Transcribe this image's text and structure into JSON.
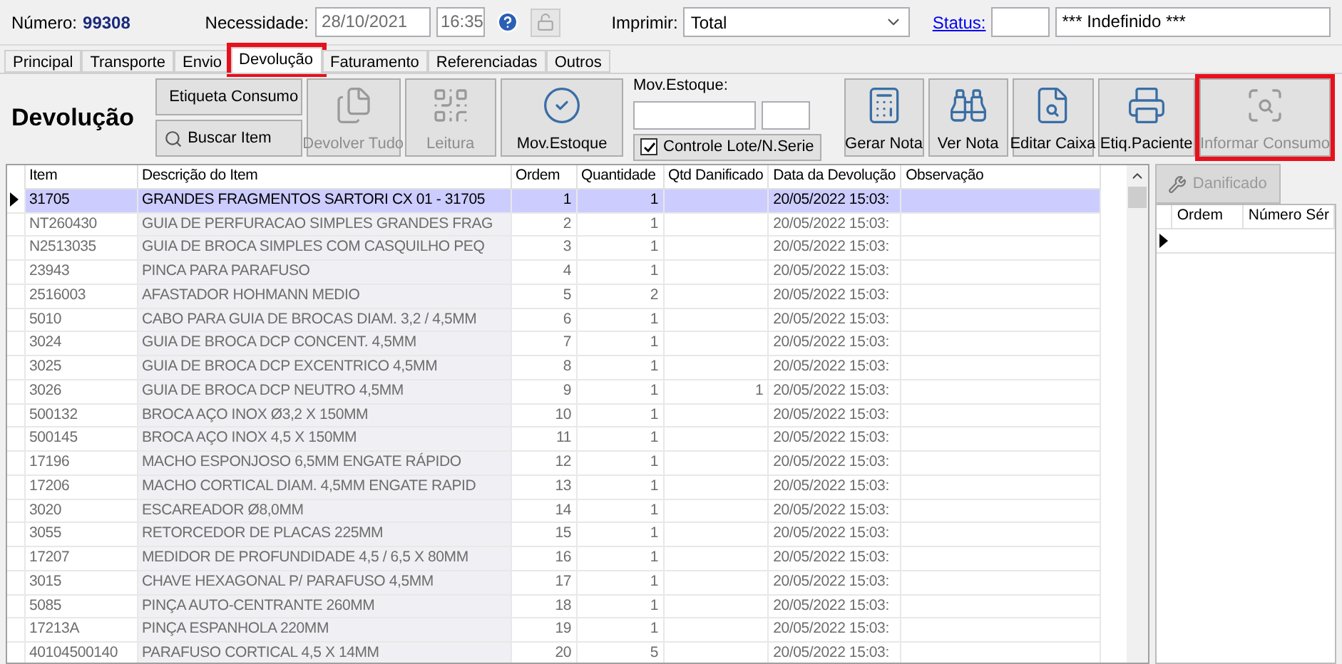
{
  "header": {
    "number_label": "Número:",
    "number": "99308",
    "need_label": "Necessidade:",
    "need_date": "28/10/2021",
    "need_time": "16:35",
    "print_label": "Imprimir:",
    "print_value": "Total",
    "status_label": "Status:",
    "status_text": "*** Indefinido ***"
  },
  "tabs": [
    {
      "label": "Principal",
      "selected": false,
      "highlighted": false
    },
    {
      "label": "Transporte",
      "selected": false,
      "highlighted": false
    },
    {
      "label": "Envio",
      "selected": false,
      "highlighted": false
    },
    {
      "label": "Devolução",
      "selected": true,
      "highlighted": true
    },
    {
      "label": "Faturamento",
      "selected": false,
      "highlighted": false
    },
    {
      "label": "Referenciadas",
      "selected": false,
      "highlighted": false
    },
    {
      "label": "Outros",
      "selected": false,
      "highlighted": false
    }
  ],
  "toolbar": {
    "title": "Devolução",
    "small_buttons": [
      {
        "label": "Etiqueta Consumo"
      },
      {
        "label": "Buscar Item"
      }
    ],
    "buttons_left": [
      {
        "label": "Devolver Tudo",
        "disabled": true,
        "highlighted": false
      },
      {
        "label": "Leitura",
        "disabled": true,
        "highlighted": false
      },
      {
        "label": "Mov.Estoque",
        "disabled": false,
        "highlighted": false
      }
    ],
    "stock": {
      "label": "Mov.Estoque:",
      "check_label": "Controle Lote/N.Serie",
      "checked": true
    },
    "buttons_right": [
      {
        "label": "Gerar Nota",
        "disabled": false,
        "highlighted": false
      },
      {
        "label": "Ver Nota",
        "disabled": false,
        "highlighted": false
      },
      {
        "label": "Editar Caixa",
        "disabled": false,
        "highlighted": false
      },
      {
        "label": "Etiq.Paciente",
        "disabled": false,
        "highlighted": false
      },
      {
        "label": "Informar Consumo",
        "disabled": true,
        "highlighted": true
      }
    ]
  },
  "table": {
    "columns": [
      "Item",
      "Descrição do Item",
      "Ordem",
      "Quantidade",
      "Qtd Danificado",
      "Data da Devolução",
      "Observação"
    ],
    "rows": [
      {
        "selected": true,
        "cells": [
          "31705",
          "GRANDES FRAGMENTOS SARTORI CX 01 - 31705",
          "1",
          "1",
          "",
          "20/05/2022 15:03:",
          ""
        ]
      },
      {
        "selected": false,
        "cells": [
          "NT260430",
          "GUIA DE PERFURACAO SIMPLES GRANDES FRAG",
          "2",
          "1",
          "",
          "20/05/2022 15:03:",
          ""
        ]
      },
      {
        "selected": false,
        "cells": [
          "N2513035",
          "GUIA DE BROCA SIMPLES COM CASQUILHO PEQ",
          "3",
          "1",
          "",
          "20/05/2022 15:03:",
          ""
        ]
      },
      {
        "selected": false,
        "cells": [
          "23943",
          "PINCA PARA PARAFUSO",
          "4",
          "1",
          "",
          "20/05/2022 15:03:",
          ""
        ]
      },
      {
        "selected": false,
        "cells": [
          "2516003",
          "AFASTADOR HOHMANN MEDIO",
          "5",
          "2",
          "",
          "20/05/2022 15:03:",
          ""
        ]
      },
      {
        "selected": false,
        "cells": [
          "5010",
          "CABO PARA GUIA DE BROCAS DIAM. 3,2 / 4,5MM",
          "6",
          "1",
          "",
          "20/05/2022 15:03:",
          ""
        ]
      },
      {
        "selected": false,
        "cells": [
          "3024",
          "GUIA DE BROCA DCP CONCENT. 4,5MM",
          "7",
          "1",
          "",
          "20/05/2022 15:03:",
          ""
        ]
      },
      {
        "selected": false,
        "cells": [
          "3025",
          "GUIA DE BROCA DCP EXCENTRICO 4,5MM",
          "8",
          "1",
          "",
          "20/05/2022 15:03:",
          ""
        ]
      },
      {
        "selected": false,
        "cells": [
          "3026",
          "GUIA DE BROCA DCP NEUTRO 4,5MM",
          "9",
          "1",
          "1",
          "20/05/2022 15:03:",
          ""
        ]
      },
      {
        "selected": false,
        "cells": [
          "500132",
          "BROCA AÇO INOX Ø3,2 X 150MM",
          "10",
          "1",
          "",
          "20/05/2022 15:03:",
          ""
        ]
      },
      {
        "selected": false,
        "cells": [
          "500145",
          "BROCA AÇO INOX 4,5 X 150MM",
          "11",
          "1",
          "",
          "20/05/2022 15:03:",
          ""
        ]
      },
      {
        "selected": false,
        "cells": [
          "17196",
          "MACHO ESPONJOSO 6,5MM ENGATE RÁPIDO",
          "12",
          "1",
          "",
          "20/05/2022 15:03:",
          ""
        ]
      },
      {
        "selected": false,
        "cells": [
          "17206",
          "MACHO CORTICAL DIAM. 4,5MM ENGATE RAPID",
          "13",
          "1",
          "",
          "20/05/2022 15:03:",
          ""
        ]
      },
      {
        "selected": false,
        "cells": [
          "3020",
          "ESCAREADOR Ø8,0MM",
          "14",
          "1",
          "",
          "20/05/2022 15:03:",
          ""
        ]
      },
      {
        "selected": false,
        "cells": [
          "3055",
          "RETORCEDOR DE PLACAS 225MM",
          "15",
          "1",
          "",
          "20/05/2022 15:03:",
          ""
        ]
      },
      {
        "selected": false,
        "cells": [
          "17207",
          "MEDIDOR DE PROFUNDIDADE 4,5 / 6,5 X 80MM",
          "16",
          "1",
          "",
          "20/05/2022 15:03:",
          ""
        ]
      },
      {
        "selected": false,
        "cells": [
          "3015",
          "CHAVE HEXAGONAL P/ PARAFUSO 4,5MM",
          "17",
          "1",
          "",
          "20/05/2022 15:03:",
          ""
        ]
      },
      {
        "selected": false,
        "cells": [
          "5085",
          "PINÇA AUTO-CENTRANTE 260MM",
          "18",
          "1",
          "",
          "20/05/2022 15:03:",
          ""
        ]
      },
      {
        "selected": false,
        "cells": [
          "17213A",
          "PINÇA ESPANHOLA 220MM",
          "19",
          "1",
          "",
          "20/05/2022 15:03:",
          ""
        ]
      },
      {
        "selected": false,
        "cells": [
          "40104500140",
          "PARAFUSO CORTICAL 4,5 X 14MM",
          "20",
          "5",
          "",
          "20/05/2022 15:03:",
          ""
        ]
      }
    ]
  },
  "side_panel": {
    "tab": {
      "label": "Danificado",
      "disabled": true
    },
    "columns": [
      "Ordem",
      "Número Sér"
    ]
  }
}
